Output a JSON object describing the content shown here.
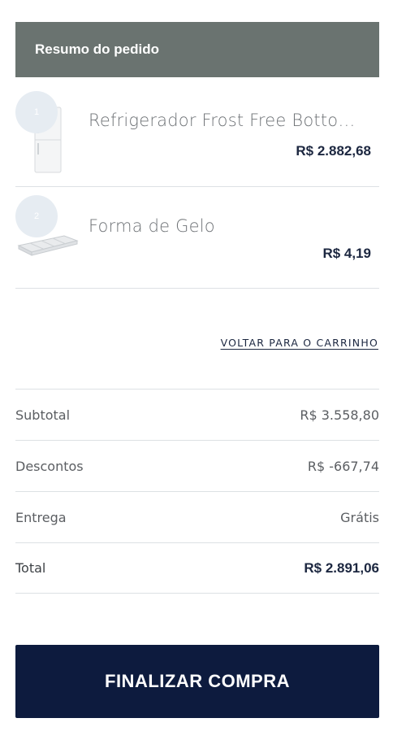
{
  "header": {
    "title": "Resumo do pedido"
  },
  "items": [
    {
      "qty": "1",
      "name": "Refrigerador Frost Free Bottom Freezer",
      "price": "R$ 2.882,68",
      "icon": "refrigerator-thumbnail"
    },
    {
      "qty": "2",
      "name": "Forma de Gelo",
      "price": "R$ 4,19",
      "icon": "ice-tray-thumbnail"
    }
  ],
  "back_link": "VOLTAR PARA O CARRINHO",
  "summary": {
    "subtotal_label": "Subtotal",
    "subtotal_value": "R$ 3.558,80",
    "discount_label": "Descontos",
    "discount_value": "R$ -667,74",
    "delivery_label": "Entrega",
    "delivery_value": "Grátis",
    "total_label": "Total",
    "total_value": "R$ 2.891,06"
  },
  "checkout_label": "FINALIZAR COMPRA",
  "colors": {
    "header_bg": "#6a7370",
    "button_bg": "#0d1b3e",
    "price_text": "#1c2740"
  }
}
